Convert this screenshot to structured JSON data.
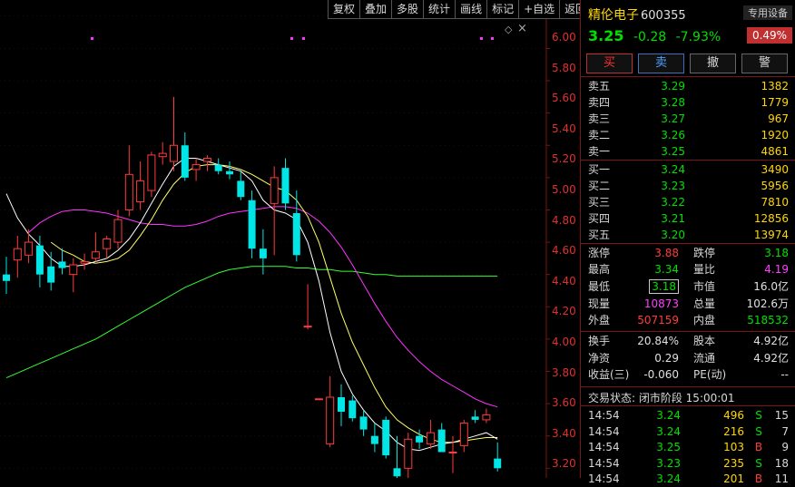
{
  "toolbar": [
    "复权",
    "叠加",
    "多股",
    "统计",
    "画线",
    "标记",
    "+自选",
    "返回"
  ],
  "chart": {
    "y_labels": [
      "6.00",
      "5.80",
      "5.60",
      "5.40",
      "5.20",
      "5.00",
      "4.80",
      "4.60",
      "4.40",
      "4.20",
      "4.00",
      "3.80",
      "3.60",
      "3.40",
      "3.20"
    ],
    "colors": {
      "up": "#ff3b3b",
      "down": "#00e5e5",
      "ma_white": "#ffffff",
      "ma_yellow": "#ffff66",
      "ma_magenta": "#ff33ff",
      "ma_green": "#33ff33",
      "grid": "#7a1515"
    }
  },
  "chart_data": {
    "type": "candlestick",
    "ylim": [
      3.14,
      6.1
    ],
    "candles": [
      {
        "o": 4.4,
        "h": 4.51,
        "l": 4.28,
        "c": 4.36
      },
      {
        "o": 4.49,
        "h": 4.64,
        "l": 4.38,
        "c": 4.56
      },
      {
        "o": 4.52,
        "h": 4.68,
        "l": 4.47,
        "c": 4.6
      },
      {
        "o": 4.58,
        "h": 4.64,
        "l": 4.32,
        "c": 4.4
      },
      {
        "o": 4.45,
        "h": 4.54,
        "l": 4.3,
        "c": 4.35
      },
      {
        "o": 4.48,
        "h": 4.56,
        "l": 4.4,
        "c": 4.44
      },
      {
        "o": 4.4,
        "h": 4.5,
        "l": 4.29,
        "c": 4.46
      },
      {
        "o": 4.47,
        "h": 4.53,
        "l": 4.43,
        "c": 4.48
      },
      {
        "o": 4.5,
        "h": 4.66,
        "l": 4.48,
        "c": 4.54
      },
      {
        "o": 4.56,
        "h": 4.64,
        "l": 4.5,
        "c": 4.62
      },
      {
        "o": 4.6,
        "h": 4.8,
        "l": 4.56,
        "c": 4.74
      },
      {
        "o": 4.8,
        "h": 5.2,
        "l": 4.76,
        "c": 5.02
      },
      {
        "o": 4.85,
        "h": 5.1,
        "l": 4.8,
        "c": 4.98
      },
      {
        "o": 4.92,
        "h": 5.16,
        "l": 4.88,
        "c": 5.14
      },
      {
        "o": 5.13,
        "h": 5.22,
        "l": 5.08,
        "c": 5.15
      },
      {
        "o": 5.1,
        "h": 5.5,
        "l": 5.04,
        "c": 5.2
      },
      {
        "o": 5.2,
        "h": 5.28,
        "l": 4.98,
        "c": 5.0
      },
      {
        "o": 5.05,
        "h": 5.12,
        "l": 4.98,
        "c": 5.08
      },
      {
        "o": 5.1,
        "h": 5.14,
        "l": 5.04,
        "c": 5.12
      },
      {
        "o": 5.08,
        "h": 5.12,
        "l": 5.02,
        "c": 5.04
      },
      {
        "o": 5.04,
        "h": 5.1,
        "l": 4.99,
        "c": 5.02
      },
      {
        "o": 4.98,
        "h": 5.04,
        "l": 4.86,
        "c": 4.88
      },
      {
        "o": 4.86,
        "h": 4.92,
        "l": 4.5,
        "c": 4.56
      },
      {
        "o": 4.56,
        "h": 4.68,
        "l": 4.4,
        "c": 4.5
      },
      {
        "o": 4.84,
        "h": 5.07,
        "l": 4.52,
        "c": 5.0
      },
      {
        "o": 5.06,
        "h": 5.12,
        "l": 4.8,
        "c": 4.84
      },
      {
        "o": 4.78,
        "h": 4.92,
        "l": 4.48,
        "c": 4.52
      },
      {
        "o": 4.08,
        "h": 4.34,
        "l": 4.06,
        "c": 4.08
      },
      {
        "o": 3.63,
        "h": 3.63,
        "l": 3.63,
        "c": 3.63
      },
      {
        "o": 3.35,
        "h": 3.77,
        "l": 3.33,
        "c": 3.64
      },
      {
        "o": 3.64,
        "h": 3.72,
        "l": 3.46,
        "c": 3.55
      },
      {
        "o": 3.62,
        "h": 3.65,
        "l": 3.49,
        "c": 3.51
      },
      {
        "o": 3.52,
        "h": 3.56,
        "l": 3.4,
        "c": 3.44
      },
      {
        "o": 3.4,
        "h": 3.48,
        "l": 3.3,
        "c": 3.35
      },
      {
        "o": 3.5,
        "h": 3.52,
        "l": 3.26,
        "c": 3.28
      },
      {
        "o": 3.2,
        "h": 3.4,
        "l": 3.14,
        "c": 3.15
      },
      {
        "o": 3.2,
        "h": 3.42,
        "l": 3.14,
        "c": 3.38
      },
      {
        "o": 3.4,
        "h": 3.44,
        "l": 3.32,
        "c": 3.36
      },
      {
        "o": 3.35,
        "h": 3.5,
        "l": 3.32,
        "c": 3.42
      },
      {
        "o": 3.44,
        "h": 3.48,
        "l": 3.3,
        "c": 3.3
      },
      {
        "o": 3.3,
        "h": 3.4,
        "l": 3.17,
        "c": 3.3
      },
      {
        "o": 3.34,
        "h": 3.5,
        "l": 3.3,
        "c": 3.48
      },
      {
        "o": 3.52,
        "h": 3.56,
        "l": 3.48,
        "c": 3.5
      },
      {
        "o": 3.5,
        "h": 3.57,
        "l": 3.48,
        "c": 3.53
      },
      {
        "o": 3.26,
        "h": 3.36,
        "l": 3.18,
        "c": 3.2
      }
    ],
    "ma": {
      "white": [
        4.9,
        4.75,
        4.65,
        4.58,
        4.5,
        4.45,
        4.45,
        4.46,
        4.48,
        4.5,
        4.55,
        4.62,
        4.72,
        4.84,
        4.96,
        5.07,
        5.12,
        5.12,
        5.1,
        5.08,
        5.06,
        5.04,
        4.98,
        4.86,
        4.8,
        4.78,
        4.74,
        4.6,
        4.36,
        4.04,
        3.8,
        3.66,
        3.56,
        3.48,
        3.43,
        3.36,
        3.32,
        3.31,
        3.33,
        3.35,
        3.36,
        3.38,
        3.4,
        3.42,
        3.38
      ],
      "yellow": [
        null,
        null,
        null,
        null,
        4.6,
        4.55,
        4.52,
        4.48,
        4.47,
        4.48,
        4.5,
        4.55,
        4.64,
        4.74,
        4.86,
        4.96,
        5.03,
        5.07,
        5.08,
        5.08,
        5.07,
        5.05,
        5.02,
        4.98,
        4.94,
        4.92,
        4.86,
        4.76,
        4.6,
        4.38,
        4.16,
        3.98,
        3.84,
        3.7,
        3.58,
        3.5,
        3.45,
        3.41,
        3.38,
        3.36,
        3.36,
        3.37,
        3.38,
        3.39,
        3.39
      ],
      "magenta": [
        null,
        null,
        4.66,
        4.72,
        4.76,
        4.79,
        4.8,
        4.8,
        4.79,
        4.78,
        4.76,
        4.74,
        4.72,
        4.71,
        4.71,
        4.7,
        4.7,
        4.71,
        4.73,
        4.76,
        4.78,
        4.79,
        4.8,
        4.81,
        4.82,
        4.82,
        4.81,
        4.78,
        4.73,
        4.66,
        4.57,
        4.46,
        4.34,
        4.22,
        4.11,
        4.01,
        3.93,
        3.86,
        3.8,
        3.75,
        3.71,
        3.67,
        3.63,
        3.6,
        3.58
      ],
      "green": [
        3.76,
        3.79,
        3.82,
        3.85,
        3.88,
        3.91,
        3.94,
        3.97,
        4.0,
        4.04,
        4.08,
        4.12,
        4.16,
        4.2,
        4.24,
        4.28,
        4.32,
        4.35,
        4.38,
        4.41,
        4.43,
        4.44,
        4.45,
        4.45,
        4.45,
        4.45,
        4.44,
        4.44,
        4.43,
        4.43,
        4.42,
        4.42,
        4.41,
        4.4,
        4.4,
        4.39,
        4.39,
        4.39,
        4.39,
        4.39,
        4.39,
        4.39,
        4.39,
        4.39,
        4.39
      ]
    }
  },
  "panel": {
    "name": "精伦电子",
    "code": "600355",
    "price": "3.25",
    "change": "-0.28",
    "change_pct": "-7.93%",
    "special_label": "专用设备",
    "sector_pct": "0.49%",
    "actions": [
      "买",
      "卖",
      "撤",
      "警"
    ],
    "asks": [
      {
        "label": "卖五",
        "price": "3.29",
        "vol": "1382"
      },
      {
        "label": "卖四",
        "price": "3.28",
        "vol": "1779"
      },
      {
        "label": "卖三",
        "price": "3.27",
        "vol": "967"
      },
      {
        "label": "卖二",
        "price": "3.26",
        "vol": "1920"
      },
      {
        "label": "卖一",
        "price": "3.25",
        "vol": "4861"
      }
    ],
    "bids": [
      {
        "label": "买一",
        "price": "3.24",
        "vol": "3490"
      },
      {
        "label": "买二",
        "price": "3.23",
        "vol": "5956"
      },
      {
        "label": "买三",
        "price": "3.22",
        "vol": "7810"
      },
      {
        "label": "买四",
        "price": "3.21",
        "vol": "12856"
      },
      {
        "label": "买五",
        "price": "3.20",
        "vol": "13974"
      }
    ],
    "stats": {
      "limit_up_l": "涨停",
      "limit_up_v": "3.88",
      "limit_down_l": "跌停",
      "limit_down_v": "3.18",
      "high_l": "最高",
      "high_v": "3.34",
      "vol_ratio_l": "量比",
      "vol_ratio_v": "4.19",
      "low_l": "最低",
      "low_v": "3.18",
      "mkt_l": "市值",
      "mkt_v": "16.0亿",
      "cur_vol_l": "现量",
      "cur_vol_v": "10873",
      "total_l": "总量",
      "total_v": "102.6万",
      "outer_l": "外盘",
      "outer_v": "507159",
      "inner_l": "内盘",
      "inner_v": "518532",
      "turn_l": "换手",
      "turn_v": "20.84%",
      "cap_l": "股本",
      "cap_v": "4.92亿",
      "nav_l": "净资",
      "nav_v": "0.29",
      "float_l": "流通",
      "float_v": "4.92亿",
      "eps_l": "收益(三)",
      "eps_v": "-0.060",
      "pe_l": "PE(动)",
      "pe_v": "--"
    },
    "status": "交易状态: 闭市阶段 15:00:01",
    "ticks": [
      {
        "time": "14:54",
        "price": "3.24",
        "vol": "496",
        "side": "S",
        "n": "15"
      },
      {
        "time": "14:54",
        "price": "3.24",
        "vol": "216",
        "side": "S",
        "n": "7"
      },
      {
        "time": "14:54",
        "price": "3.25",
        "vol": "103",
        "side": "B",
        "n": "9"
      },
      {
        "time": "14:54",
        "price": "3.23",
        "vol": "235",
        "side": "S",
        "n": "18"
      },
      {
        "time": "14:54",
        "price": "3.24",
        "vol": "201",
        "side": "B",
        "n": "11"
      }
    ]
  }
}
